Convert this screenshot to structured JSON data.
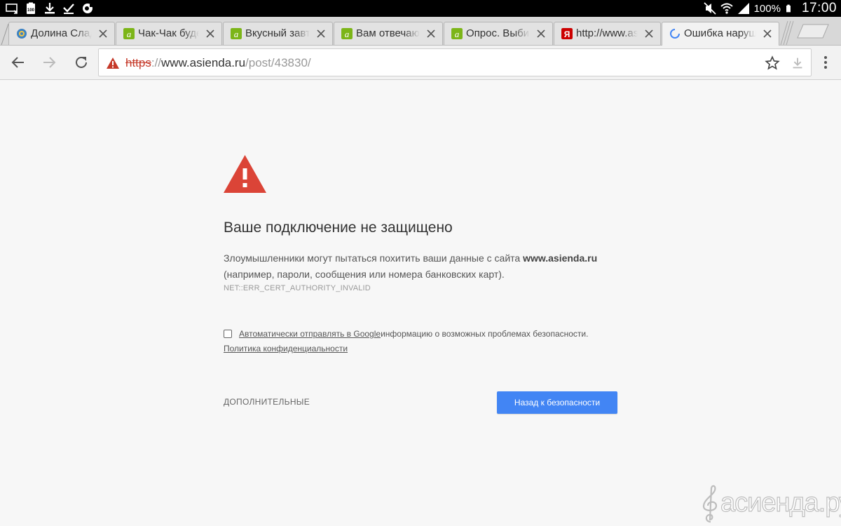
{
  "status_bar": {
    "left_icons": [
      "cast-icon",
      "battery-widget-icon",
      "download-icon",
      "check-icon",
      "media-icon"
    ],
    "battery_widget_text": "100",
    "battery_percent": "100%",
    "time": "17:00",
    "right_icons": [
      "mute-icon",
      "wifi-icon",
      "signal-icon",
      "battery-icon"
    ]
  },
  "tabs": [
    {
      "title": "Долина Сладостей",
      "favicon": "globe-favicon",
      "active": false
    },
    {
      "title": "Чак-Чак будем",
      "favicon": "asienda-favicon",
      "active": false
    },
    {
      "title": "Вкусный завтрак",
      "favicon": "asienda-favicon",
      "active": false
    },
    {
      "title": "Вам отвечают",
      "favicon": "asienda-favicon",
      "active": false
    },
    {
      "title": "Опрос. Выбираем",
      "favicon": "asienda-favicon",
      "active": false
    },
    {
      "title": "http://www.asienda.ru",
      "favicon": "yandex-favicon",
      "active": false
    },
    {
      "title": "Ошибка нарушения",
      "favicon": "loading-spinner",
      "active": true
    }
  ],
  "toolbar": {
    "url_scheme": "https",
    "url_separator": "://",
    "url_host": "www.asienda.ru",
    "url_path": "/post/43830/"
  },
  "page": {
    "heading": "Ваше подключение не защищено",
    "desc_prefix": "Злоумышленники могут пытаться похитить ваши данные с сайта ",
    "desc_site": "www.asienda.ru",
    "desc_suffix": " (например, пароли, сообщения или номера банковских карт).",
    "error_code": "NET::ERR_CERT_AUTHORITY_INVALID",
    "checkbox_link": "Автоматически отправлять в Google",
    "checkbox_text": " информацию о возможных проблемах безопасности.",
    "privacy_link": "Политика конфиденциальности",
    "advanced_label": "ДОПОЛНИТЕЛЬНЫЕ",
    "back_button": "Назад к безопасности"
  },
  "watermark": {
    "text": "асиенда.ру"
  },
  "colors": {
    "warning_red": "#db4437",
    "primary_blue": "#4285f4",
    "asienda_green": "#7cb518",
    "yandex_red": "#cc0000"
  }
}
